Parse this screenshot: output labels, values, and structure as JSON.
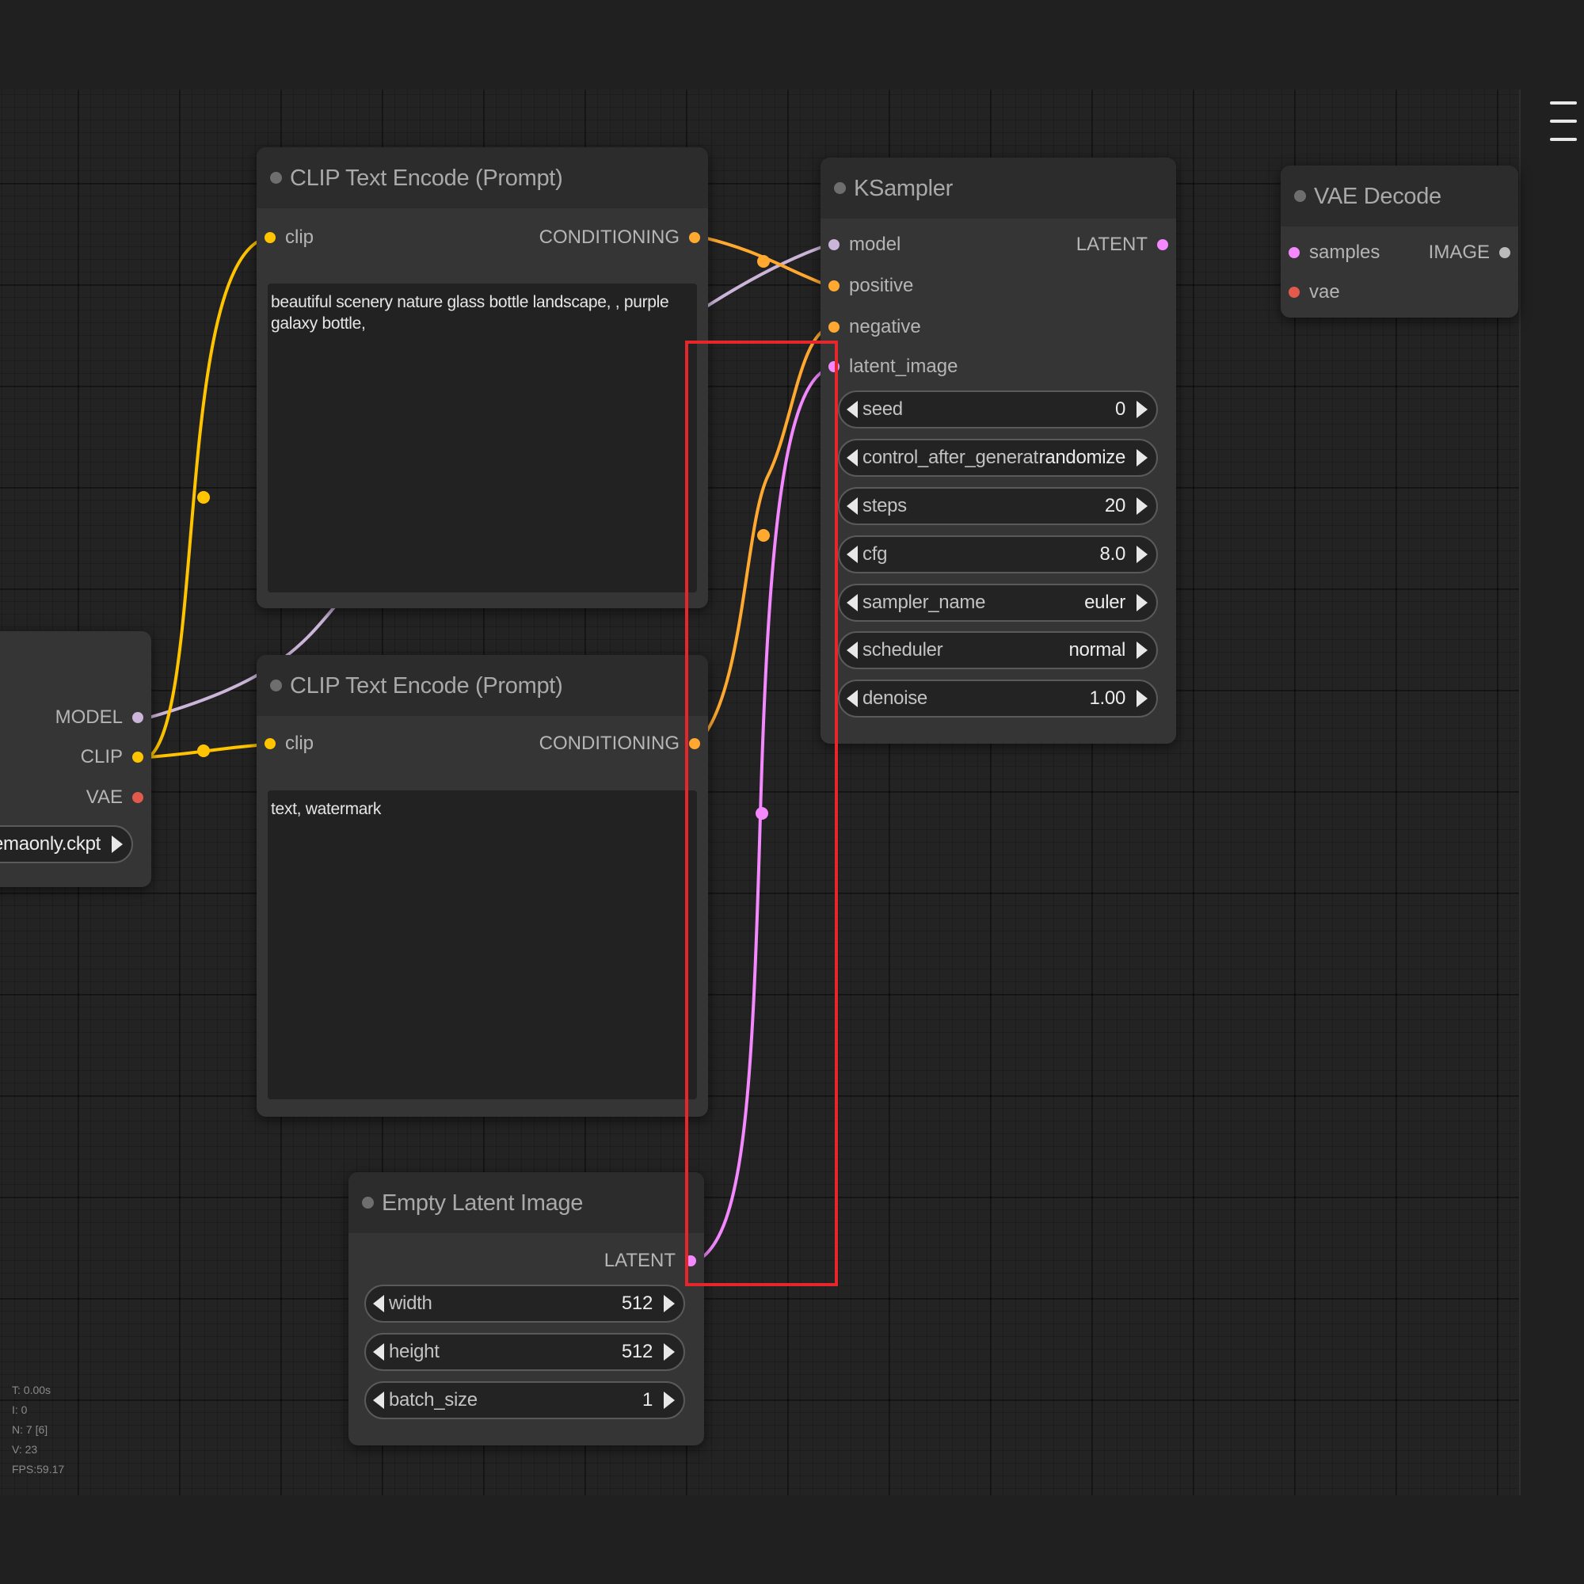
{
  "colors": {
    "canvas_bg": "#232323",
    "node_bg": "#353535",
    "node_title_bg": "#2c2c2c",
    "clip_wire": "#ffc400",
    "conditioning_wire": "#ffa931",
    "latent_wire": "#f488ff",
    "model_wire": "#cbb5d8",
    "vae_slot": "#e15a4d",
    "highlight": "#e5262b"
  },
  "nodes": {
    "checkpoint": {
      "outputs": {
        "model": "MODEL",
        "clip": "CLIP",
        "vae": "VAE"
      },
      "ckpt_value": "ed-emaonly.ckpt"
    },
    "clip_pos": {
      "title": "CLIP Text Encode (Prompt)",
      "input_clip": "clip",
      "output": "CONDITIONING",
      "text": "beautiful scenery nature glass bottle landscape, , purple galaxy bottle,"
    },
    "clip_neg": {
      "title": "CLIP Text Encode (Prompt)",
      "input_clip": "clip",
      "output": "CONDITIONING",
      "text": "text, watermark"
    },
    "ksampler": {
      "title": "KSampler",
      "inputs": {
        "model": "model",
        "positive": "positive",
        "negative": "negative",
        "latent_image": "latent_image"
      },
      "output": "LATENT",
      "widgets": [
        {
          "name": "seed",
          "value": "0"
        },
        {
          "name": "control_after_generate",
          "value": "randomize"
        },
        {
          "name": "steps",
          "value": "20"
        },
        {
          "name": "cfg",
          "value": "8.0"
        },
        {
          "name": "sampler_name",
          "value": "euler"
        },
        {
          "name": "scheduler",
          "value": "normal"
        },
        {
          "name": "denoise",
          "value": "1.00"
        }
      ]
    },
    "vae_decode": {
      "title": "VAE Decode",
      "inputs": {
        "samples": "samples",
        "vae": "vae"
      },
      "output": "IMAGE"
    },
    "empty_latent": {
      "title": "Empty Latent Image",
      "output": "LATENT",
      "widgets": [
        {
          "name": "width",
          "value": "512"
        },
        {
          "name": "height",
          "value": "512"
        },
        {
          "name": "batch_size",
          "value": "1"
        }
      ]
    }
  },
  "stats": {
    "t": "T: 0.00s",
    "i": "I: 0",
    "n": "N: 7 [6]",
    "v": "V: 23",
    "fps": "FPS:59.17"
  }
}
